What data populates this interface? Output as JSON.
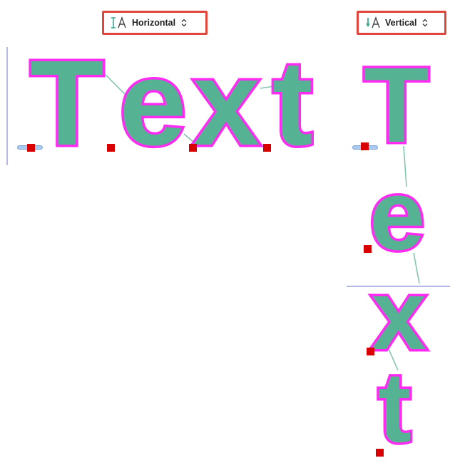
{
  "toolbar": {
    "horizontal_dropdown": {
      "label": "Horizontal",
      "icon": "text-direction-horizontal-icon"
    },
    "vertical_dropdown": {
      "label": "Vertical",
      "icon": "text-direction-vertical-icon"
    }
  },
  "canvas": {
    "horizontal_text": {
      "letters": [
        "T",
        "e",
        "x",
        "t"
      ]
    },
    "vertical_text": {
      "letters": [
        "T",
        "e",
        "x",
        "t"
      ]
    }
  },
  "colors": {
    "stitch_fill": "#55b394",
    "stitch_outline": "#ff2bf2",
    "highlight_border": "#e0463c",
    "handle": "#d80000",
    "connector": "#7fc2ae",
    "guide": "#b6b8e8"
  }
}
